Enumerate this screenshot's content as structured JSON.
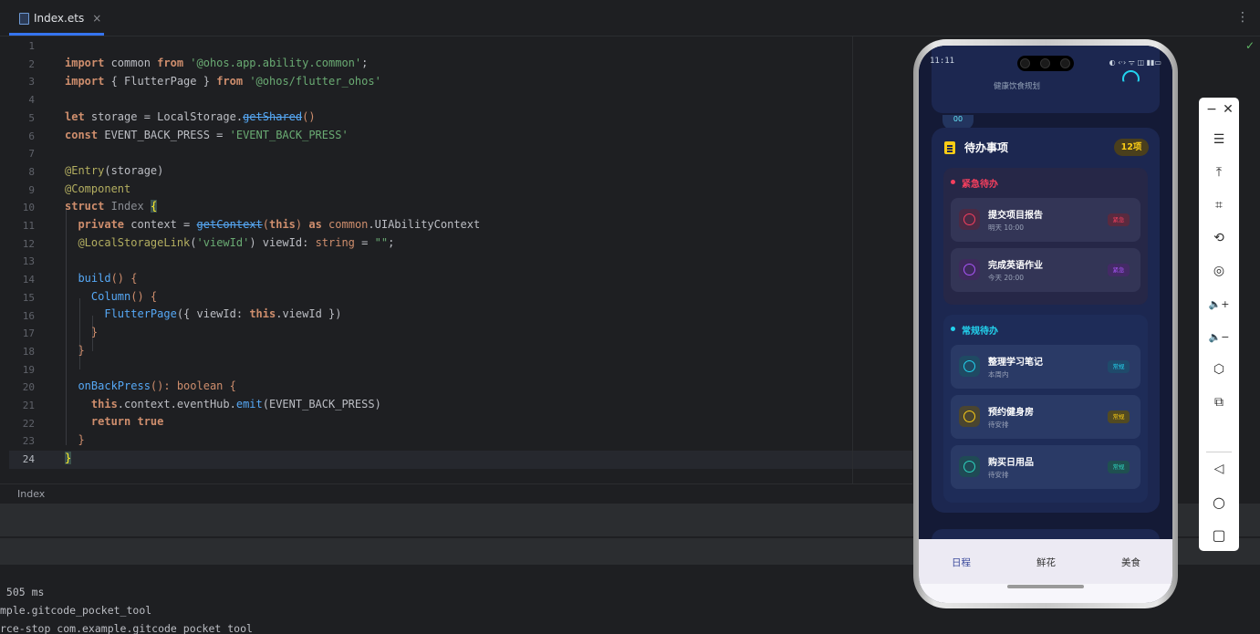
{
  "editor": {
    "tab": {
      "label": "Index.ets",
      "close_icon": "×",
      "more_icon": "⋮"
    },
    "left_edge_mark": "m",
    "line_numbers": [
      "1",
      "2",
      "3",
      "4",
      "5",
      "6",
      "7",
      "8",
      "9",
      "10",
      "11",
      "12",
      "13",
      "14",
      "15",
      "16",
      "17",
      "18",
      "19",
      "20",
      "21",
      "22",
      "23",
      "24"
    ],
    "current_line": "24",
    "code": {
      "l2": {
        "k1": "import",
        "t1": " common ",
        "k2": "from",
        "s1": " '@ohos.app.ability.common'",
        "t2": ";"
      },
      "l3": {
        "k1": "import",
        "t1": " { FlutterPage } ",
        "k2": "from",
        "s1": " '@ohos/flutter_ohos'"
      },
      "l5": {
        "k1": "let",
        "t1": " storage = LocalStorage.",
        "f1": "getShared",
        "t2": "()"
      },
      "l6": {
        "k1": "const",
        "t1": " EVENT_BACK_PRESS = ",
        "s1": "'EVENT_BACK_PRESS'"
      },
      "l8": {
        "a1": "@Entry",
        "t1": "(storage)"
      },
      "l9": {
        "a1": "@Component"
      },
      "l10": {
        "k1": "struct",
        "t1": " ",
        "n1": "Index",
        "t2": " ",
        "b1": "{"
      },
      "l11": {
        "k1": "  private",
        "t1": " context = ",
        "f1": "getContext",
        "t2": "(",
        "k2": "this",
        "t3": ") ",
        "k3": "as",
        "t4": " ",
        "c1": "common",
        "t5": ".UIAbilityContext"
      },
      "l12": {
        "a1": "  @LocalStorageLink",
        "t1": "(",
        "s1": "'viewId'",
        "t2": ") viewId: ",
        "k1": "string",
        "t3": " = ",
        "s2": "\"\"",
        "t4": ";"
      },
      "l14": {
        "f1": "  build",
        "t1": "() {"
      },
      "l15": {
        "f1": "    Column",
        "t1": "() {"
      },
      "l16": {
        "f1": "      FlutterPage",
        "t1": "({ viewId: ",
        "k1": "this",
        "t2": ".viewId })"
      },
      "l17": {
        "t1": "    }"
      },
      "l18": {
        "t1": "  }"
      },
      "l20": {
        "f1": "  onBackPress",
        "t1": "(): ",
        "k1": "boolean",
        "t2": " {"
      },
      "l21": {
        "k1": "    this",
        "t1": ".context.eventHub.",
        "f1": "emit",
        "t2": "(EVENT_BACK_PRESS)"
      },
      "l22": {
        "k1": "    return",
        "t1": " ",
        "k2": "true"
      },
      "l23": {
        "t1": "  }"
      },
      "l24": {
        "b1": "}"
      }
    },
    "breadcrumb": "Index"
  },
  "console": {
    "lines": [
      " 505 ms",
      "mple.gitcode_pocket_tool",
      "rce-stop com.example.gitcode_pocket_tool"
    ]
  },
  "phone": {
    "status": {
      "time": "11:11",
      "icons": "◐ ‹·› ᯤ ◫ ▮▮▭"
    },
    "top_card": {
      "chip": "00",
      "text": "健康饮食规划"
    },
    "todo": {
      "title": "待办事项",
      "count": "12项",
      "sections": [
        {
          "title": "紧急待办",
          "color": "#f43f5e",
          "tasks": [
            {
              "name": "提交项目报告",
              "sub": "明天 10:00",
              "tag": "紧急",
              "ring": "#f43f5e",
              "box": "#4a2a44",
              "tag_bg": "#5a2a3f",
              "tag_fg": "#f43f5e"
            },
            {
              "name": "完成英语作业",
              "sub": "今天 20:00",
              "tag": "紧急",
              "ring": "#a855f7",
              "box": "#3e2a5c",
              "tag_bg": "#442a66",
              "tag_fg": "#a855f7"
            }
          ]
        },
        {
          "title": "常规待办",
          "color": "#22d3ee",
          "tasks": [
            {
              "name": "整理学习笔记",
              "sub": "本周内",
              "tag": "常规",
              "ring": "#22d3ee",
              "box": "#1f4a63",
              "tag_bg": "#1f4a6b",
              "tag_fg": "#22d3ee"
            },
            {
              "name": "预约健身房",
              "sub": "待安排",
              "tag": "常规",
              "ring": "#facc15",
              "box": "#4a4530",
              "tag_bg": "#524a22",
              "tag_fg": "#facc15"
            },
            {
              "name": "购买日用品",
              "sub": "待安排",
              "tag": "常规",
              "ring": "#2dd4bf",
              "box": "#1f4a55",
              "tag_bg": "#1f5050",
              "tag_fg": "#2dd4bf"
            }
          ]
        }
      ]
    },
    "nav": {
      "items": [
        "日程",
        "鲜花",
        "美食"
      ],
      "active": "日程"
    }
  },
  "emulator_toolbar": {
    "buttons": [
      {
        "name": "minimize-icon",
        "glyph": "−"
      },
      {
        "name": "close-icon",
        "glyph": "✕"
      },
      {
        "name": "menu-icon",
        "glyph": "☰"
      },
      {
        "name": "pin-off-icon",
        "glyph": "⤒"
      },
      {
        "name": "crop-icon",
        "glyph": "⌗"
      },
      {
        "name": "rotate-icon",
        "glyph": "⟲"
      },
      {
        "name": "screenshot-icon",
        "glyph": "◎"
      },
      {
        "name": "volume-up-icon",
        "glyph": "🔈+"
      },
      {
        "name": "volume-down-icon",
        "glyph": "🔈−"
      },
      {
        "name": "fold-icon",
        "glyph": "⬡"
      },
      {
        "name": "multi-device-icon",
        "glyph": "⧉"
      },
      {
        "name": "back-icon",
        "glyph": "◁"
      },
      {
        "name": "home-icon",
        "glyph": "○"
      },
      {
        "name": "recents-icon",
        "glyph": "▢"
      }
    ]
  },
  "status_check_icon": "✓"
}
